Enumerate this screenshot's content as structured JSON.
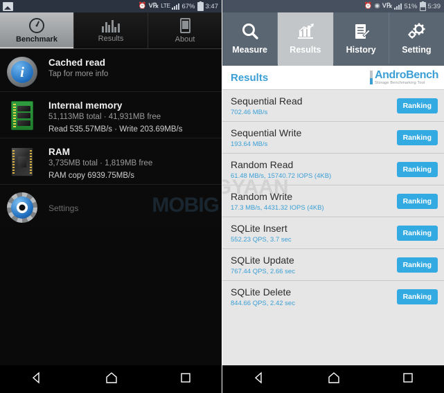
{
  "left_phone": {
    "status_bar": {
      "image_icon": "image-icon",
      "alarm_icon": "alarm-clock-icon",
      "volte_icon": "volte-icon",
      "lte_icon": "lte-icon",
      "signal_icon": "signal-bars-icon",
      "battery_percent": "67%",
      "battery_icon": "battery-charging-icon",
      "time": "3:47"
    },
    "tabs": [
      {
        "label": "Benchmark",
        "icon": "speedometer-icon",
        "active": true
      },
      {
        "label": "Results",
        "icon": "bar-chart-icon",
        "active": false
      },
      {
        "label": "About",
        "icon": "phone-icon",
        "active": false
      }
    ],
    "rows": [
      {
        "icon": "info-icon",
        "title": "Cached read",
        "subtitle": "Tap for more info",
        "detail": ""
      },
      {
        "icon": "memory-chip-icon",
        "title": "Internal memory",
        "subtitle": "51,113MB total · 41,931MB free",
        "detail": "Read 535.57MB/s · Write 203.69MB/s"
      },
      {
        "icon": "ram-chip-icon",
        "title": "RAM",
        "subtitle": "3,735MB total · 1,819MB free",
        "detail": "RAM copy 6939.75MB/s"
      }
    ],
    "settings_row": {
      "icon": "gear-eye-icon",
      "label": "Settings"
    },
    "watermark": "MOBIG"
  },
  "right_phone": {
    "status_bar": {
      "alarm_icon": "alarm-clock-icon",
      "wifi_icon": "wifi-icon",
      "volte_icon": "volte-icon",
      "signal_icon": "signal-bars-icon",
      "battery_percent": "51%",
      "battery_icon": "battery-icon",
      "time": "5:39"
    },
    "tabs": [
      {
        "label": "Measure",
        "icon": "search-icon",
        "active": false
      },
      {
        "label": "Results",
        "icon": "chart-growth-icon",
        "active": true
      },
      {
        "label": "History",
        "icon": "document-list-icon",
        "active": false
      },
      {
        "label": "Setting",
        "icon": "gears-icon",
        "active": false
      }
    ],
    "header": {
      "title": "Results",
      "logo_primary": "Andro",
      "logo_secondary": "Bench",
      "logo_tagline": "Storage Benchmarking Tool"
    },
    "button_label": "Ranking",
    "results": [
      {
        "name": "Sequential Read",
        "value": "702.46 MB/s"
      },
      {
        "name": "Sequential Write",
        "value": "193.64 MB/s"
      },
      {
        "name": "Random Read",
        "value": "61.48 MB/s, 15740.72 IOPS (4KB)"
      },
      {
        "name": "Random Write",
        "value": "17.3 MB/s, 4431.32 IOPS (4KB)"
      },
      {
        "name": "SQLite Insert",
        "value": "552.23 QPS, 3.7 sec"
      },
      {
        "name": "SQLite Update",
        "value": "767.44 QPS, 2.66 sec"
      },
      {
        "name": "SQLite Delete",
        "value": "844.66 QPS, 2.42 sec"
      }
    ],
    "watermark": "GYAAN"
  },
  "nav_bar": {
    "back": "back-icon",
    "home": "home-icon",
    "recents": "recents-icon"
  },
  "colors": {
    "accent_blue": "#33aae2",
    "header_blue": "#3b9fd6",
    "nav_slate": "#5b6673",
    "active_tab": "#c3c6c8",
    "list_bg": "#e6e6e6"
  }
}
